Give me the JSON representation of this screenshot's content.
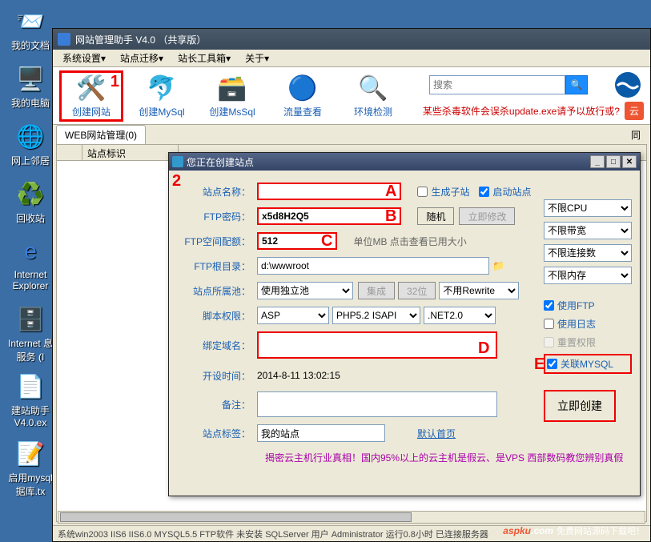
{
  "desktop": {
    "icons": [
      "我的文档",
      "我的电脑",
      "网上邻居",
      "回收站",
      "Internet Explorer",
      "Internet 息服务 (I",
      "建站助手 V4.0.ex",
      "启用mysql 据库.tx"
    ]
  },
  "window": {
    "title": "网站管理助手  V4.0 （共享版）"
  },
  "menu": {
    "items": [
      "系统设置▾",
      "站点迁移▾",
      "站长工具箱▾",
      "关于▾"
    ]
  },
  "toolbar": {
    "create_site": "创建网站",
    "create_mysql": "创建MySql",
    "create_mssql": "创建MsSql",
    "traffic": "流量查看",
    "env_check": "环境检测",
    "search_placeholder": "搜索",
    "warning": "某些杀毒软件会误杀update.exe请予以放行或?",
    "cloud": "云"
  },
  "tabs": {
    "active": "WEB网站管理(0)",
    "col_header": "站点标识",
    "rt": "同"
  },
  "popup": {
    "title": "您正在创建站点",
    "labels": {
      "site_name": "站点名称：",
      "ftp_pass": "FTP密码：",
      "ftp_quota": "FTP空间配额：",
      "ftp_root": "FTP根目录：",
      "pool": "站点所属池：",
      "script": "脚本权限：",
      "domain": "绑定域名：",
      "open_time": "开设时间：",
      "remark": "备注：",
      "tag": "站点标签："
    },
    "values": {
      "site_name": "",
      "ftp_pass": "x5d8H2Q5",
      "ftp_quota": "512",
      "quota_hint": "单位MB 点击查看已用大小",
      "ftp_root": "d:\\wwwroot",
      "pool": "使用独立池",
      "btn_jc": "集成",
      "btn_32": "32位",
      "rewrite": "不用Rewrite",
      "asp": "ASP",
      "php": "PHP5.2 ISAPI",
      "net": ".NET2.0",
      "open_time": "2014-8-11 13:02:15",
      "tag_val": "我的站点",
      "default_page": "默认首页"
    },
    "buttons": {
      "random": "随机",
      "modify": "立即修改",
      "create": "立即创建"
    },
    "checkboxes": {
      "child": "生成子站",
      "start": "启动站点"
    },
    "side": {
      "cpu": "不限CPU",
      "bw": "不限带宽",
      "conn": "不限连接数",
      "mem": "不限内存",
      "use_ftp": "使用FTP",
      "use_log": "使用日志",
      "reset_perm": "重置权限",
      "relate_mysql": "关联MYSQL"
    },
    "bottom_hint": "揭密云主机行业真相！国内95%以上的云主机是假云、是VPS 西部数码教您辨别真假"
  },
  "statusbar": "系统win2003  IIS6 IIS6.0  MYSQL5.5  FTP软件   未安装 SQLServer 用户 Administrator 运行0.8小时  已连接服务器",
  "watermark": {
    "brand": "aspku",
    "suffix": ".com",
    "sub": "免费网站源码下载吧！"
  }
}
